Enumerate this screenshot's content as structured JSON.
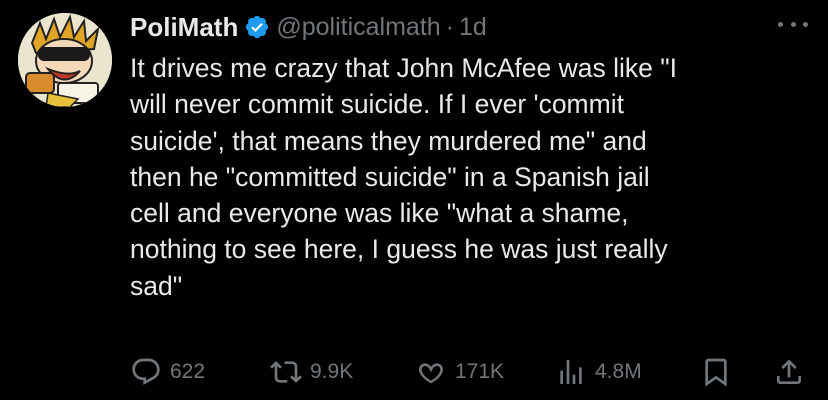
{
  "author": {
    "name": "PoliMath",
    "handle": "@politicalmath",
    "separator": "·",
    "time": "1d"
  },
  "tweet": {
    "text": "It drives me crazy that John McAfee was like \"I\nwill never commit suicide. If I ever 'commit\nsuicide', that means they murdered me\"  and\nthen he \"committed suicide\" in a Spanish jail\ncell and everyone was like \"what a shame,\nnothing to see here, I guess he was just really\nsad\""
  },
  "actions": {
    "replies": "622",
    "retweets": "9.9K",
    "likes": "171K",
    "views": "4.8M"
  },
  "icons": {
    "verified": "verified-badge-icon",
    "more": "more-dots-icon",
    "reply": "reply-icon",
    "retweet": "retweet-icon",
    "like": "heart-icon",
    "views": "views-chart-icon",
    "bookmark": "bookmark-icon",
    "share": "share-icon"
  },
  "colors": {
    "background": "#000000",
    "text": "#e7e9ea",
    "muted": "#71767b",
    "verified": "#1d9bf0"
  }
}
